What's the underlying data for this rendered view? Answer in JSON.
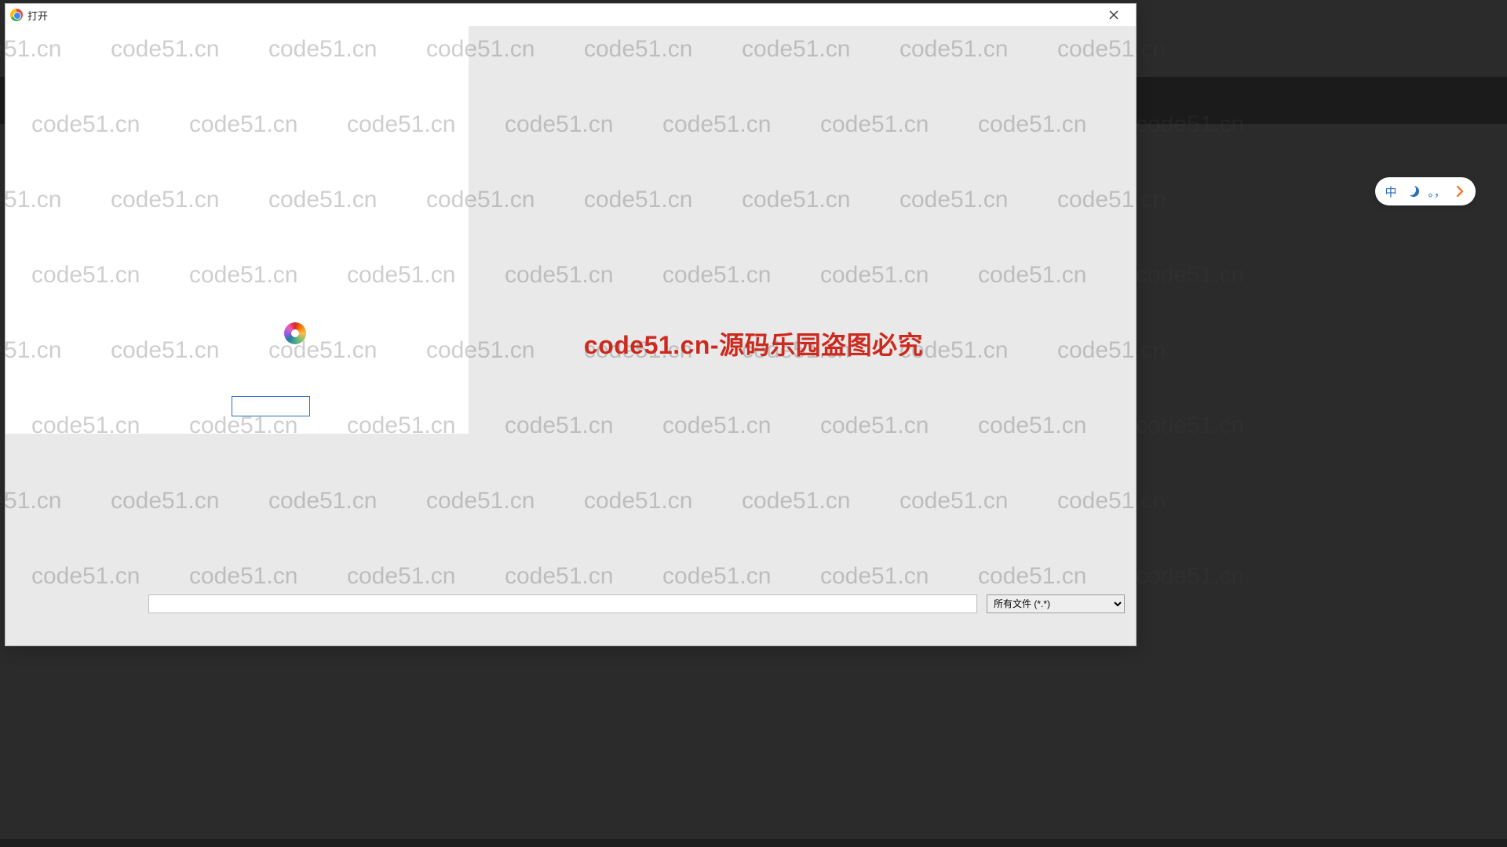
{
  "dialog": {
    "title": "打开",
    "close_tooltip": "关闭"
  },
  "bottom": {
    "filename_value": "",
    "filetype_selected": "所有文件 (*.*)",
    "filetype_options": [
      "所有文件 (*.*)"
    ]
  },
  "ime": {
    "mode_label": "中",
    "punct_label": "。，"
  },
  "watermark": {
    "text": "code51.cn",
    "center_text": "code51.cn-源码乐园盗图必究"
  },
  "small_input": {
    "value": ""
  }
}
